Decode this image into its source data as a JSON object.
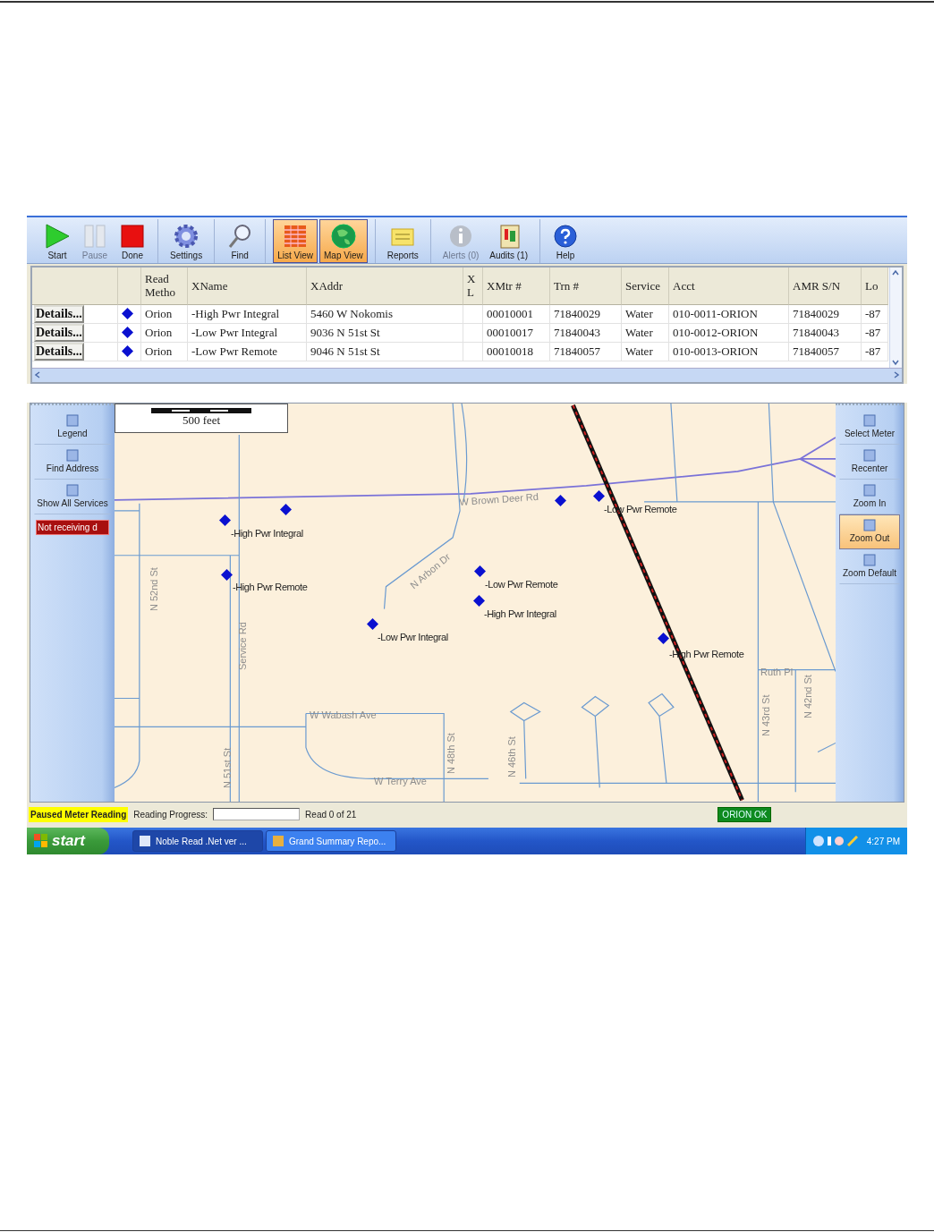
{
  "toolbar": {
    "groups": [
      {
        "buttons": [
          {
            "label": "Start",
            "disabled": false,
            "selected": false
          },
          {
            "label": "Pause",
            "disabled": true,
            "selected": false
          },
          {
            "label": "Done",
            "disabled": false,
            "selected": false
          }
        ]
      },
      {
        "buttons": [
          {
            "label": "Settings",
            "disabled": false,
            "selected": false
          }
        ]
      },
      {
        "buttons": [
          {
            "label": "Find",
            "disabled": false,
            "selected": false
          }
        ]
      },
      {
        "buttons": [
          {
            "label": "List View",
            "disabled": false,
            "selected": true
          },
          {
            "label": "Map View",
            "disabled": false,
            "selected": true
          }
        ]
      },
      {
        "buttons": [
          {
            "label": "Reports",
            "disabled": false,
            "selected": false
          }
        ]
      },
      {
        "buttons": [
          {
            "label": "Alerts (0)",
            "disabled": true,
            "selected": false
          },
          {
            "label": "Audits (1)",
            "disabled": false,
            "selected": false
          }
        ]
      },
      {
        "buttons": [
          {
            "label": "Help",
            "disabled": false,
            "selected": false
          }
        ]
      }
    ]
  },
  "table": {
    "columns": [
      "Read Metho",
      "XName",
      "XAddr",
      "X L",
      "XMtr #",
      "Trn #",
      "Service",
      "Acct",
      "AMR S/N",
      "Lo"
    ],
    "rows": [
      {
        "button": "Details...",
        "cells": [
          "Orion",
          "-High Pwr Integral",
          "5460 W Nokomis",
          null,
          "00010001",
          "71840029",
          "Water",
          "010-0011-ORION",
          "71840029",
          "-87"
        ]
      },
      {
        "button": "Details...",
        "cells": [
          "Orion",
          "-Low Pwr Integral",
          "9036 N 51st St",
          null,
          "00010017",
          "71840043",
          "Water",
          "010-0012-ORION",
          "71840043",
          "-87"
        ]
      },
      {
        "button": "Details...",
        "cells": [
          "Orion",
          "-Low Pwr Remote",
          "9046 N 51st St",
          null,
          "00010018",
          "71840057",
          "Water",
          "010-0013-ORION",
          "71840057",
          "-87"
        ]
      }
    ]
  },
  "map": {
    "left_panel": [
      {
        "kind": "tool",
        "label": "Legend"
      },
      {
        "kind": "tool",
        "label": "Find Address"
      },
      {
        "kind": "tool",
        "label": "Show All Services"
      },
      {
        "kind": "alert",
        "label": "Not receiving d"
      }
    ],
    "scale": "500 feet",
    "streets": [
      "W Brown Deer Rd",
      "N Arbon Dr",
      "N 52nd St",
      "Service Rd",
      "W Wabash Ave",
      "N 51st St",
      "W Terry Ave",
      "N 48th St",
      "N 46th St",
      "Ruth Pl",
      "N 43rd St",
      "N 42nd St"
    ],
    "meters": [
      {
        "label": "-High Pwr Integral"
      },
      {
        "label": "-High Pwr Remote"
      },
      {
        "label": "-Low Pwr Integral"
      },
      {
        "label": "-Low Pwr Remote"
      },
      {
        "label": "-High Pwr Integral"
      },
      {
        "label": "-Low Pwr Remote"
      },
      {
        "label": "-High Pwr Remote"
      }
    ],
    "right_panel": [
      {
        "label": "Select Meter",
        "selected": false
      },
      {
        "label": "Recenter",
        "selected": false
      },
      {
        "label": "Zoom In",
        "selected": false
      },
      {
        "label": "Zoom Out",
        "selected": true
      },
      {
        "label": "Zoom Default",
        "selected": false
      }
    ]
  },
  "status_bar": {
    "mode": "Paused Meter Reading",
    "progress_label": "Reading Progress:",
    "progress": {
      "level": 0
    },
    "count": "Read 0 of 21",
    "connection": "ORION OK"
  },
  "taskbar": {
    "start": "start",
    "tasks": [
      {
        "label": "Noble Read .Net ver ...",
        "selected": true
      },
      {
        "label": "Grand Summary Repo...",
        "selected": false
      }
    ],
    "clock": "4:27 PM"
  }
}
